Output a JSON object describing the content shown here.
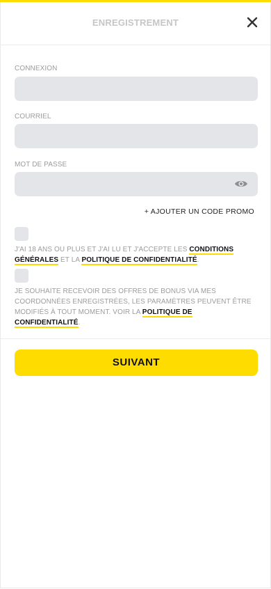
{
  "header": {
    "title": "ENREGISTREMENT",
    "close_icon": "close-icon"
  },
  "form": {
    "username_label": "CONNEXION",
    "username_value": "",
    "email_label": "COURRIEL",
    "email_value": "",
    "password_label": "MOT DE PASSE",
    "password_value": "",
    "password_toggle_icon": "eye-icon",
    "promo_link": "+ AJOUTER UN CODE PROMO"
  },
  "consents": {
    "terms": {
      "checked": false,
      "text_before": "J'AI 18 ANS OU PLUS ET J'AI LU ET J'ACCEPTE LES ",
      "link1": "CONDITIONS GÉNÉRALES",
      "text_middle": " ET LA ",
      "link2": "POLITIQUE DE CONFIDENTIALITÉ",
      "text_after": "."
    },
    "marketing": {
      "checked": false,
      "text_before": "JE SOUHAITE RECEVOIR DES OFFRES DE BONUS VIA MES COORDONNÉES ENREGISTRÉES, LES PARAMÈTRES PEUVENT ÊTRE MODIFIÉS À TOUT MOMENT. VOIR LA ",
      "link": "POLITIQUE DE CONFIDENTIALITÉ",
      "text_after": "."
    }
  },
  "actions": {
    "next_label": "SUIVANT"
  },
  "colors": {
    "accent": "#ffdc00",
    "input_bg": "#e4e5e8",
    "muted_text": "#9c9c9c"
  }
}
